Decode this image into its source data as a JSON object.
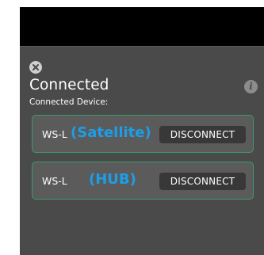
{
  "dialog": {
    "title": "Connected",
    "subtitle": "Connected Device:",
    "close_icon": "close-circle-icon",
    "info_icon": "info-icon"
  },
  "devices": [
    {
      "name": "WS-L",
      "role": "(Satellite)",
      "action": "DISCONNECT"
    },
    {
      "name": "WS-L",
      "role": "(HUB)",
      "action": "DISCONNECT"
    }
  ],
  "colors": {
    "accent": "#1d9ee6",
    "border": "#3a9a6a",
    "panel": "#4a4a4a",
    "button": "#383838"
  }
}
